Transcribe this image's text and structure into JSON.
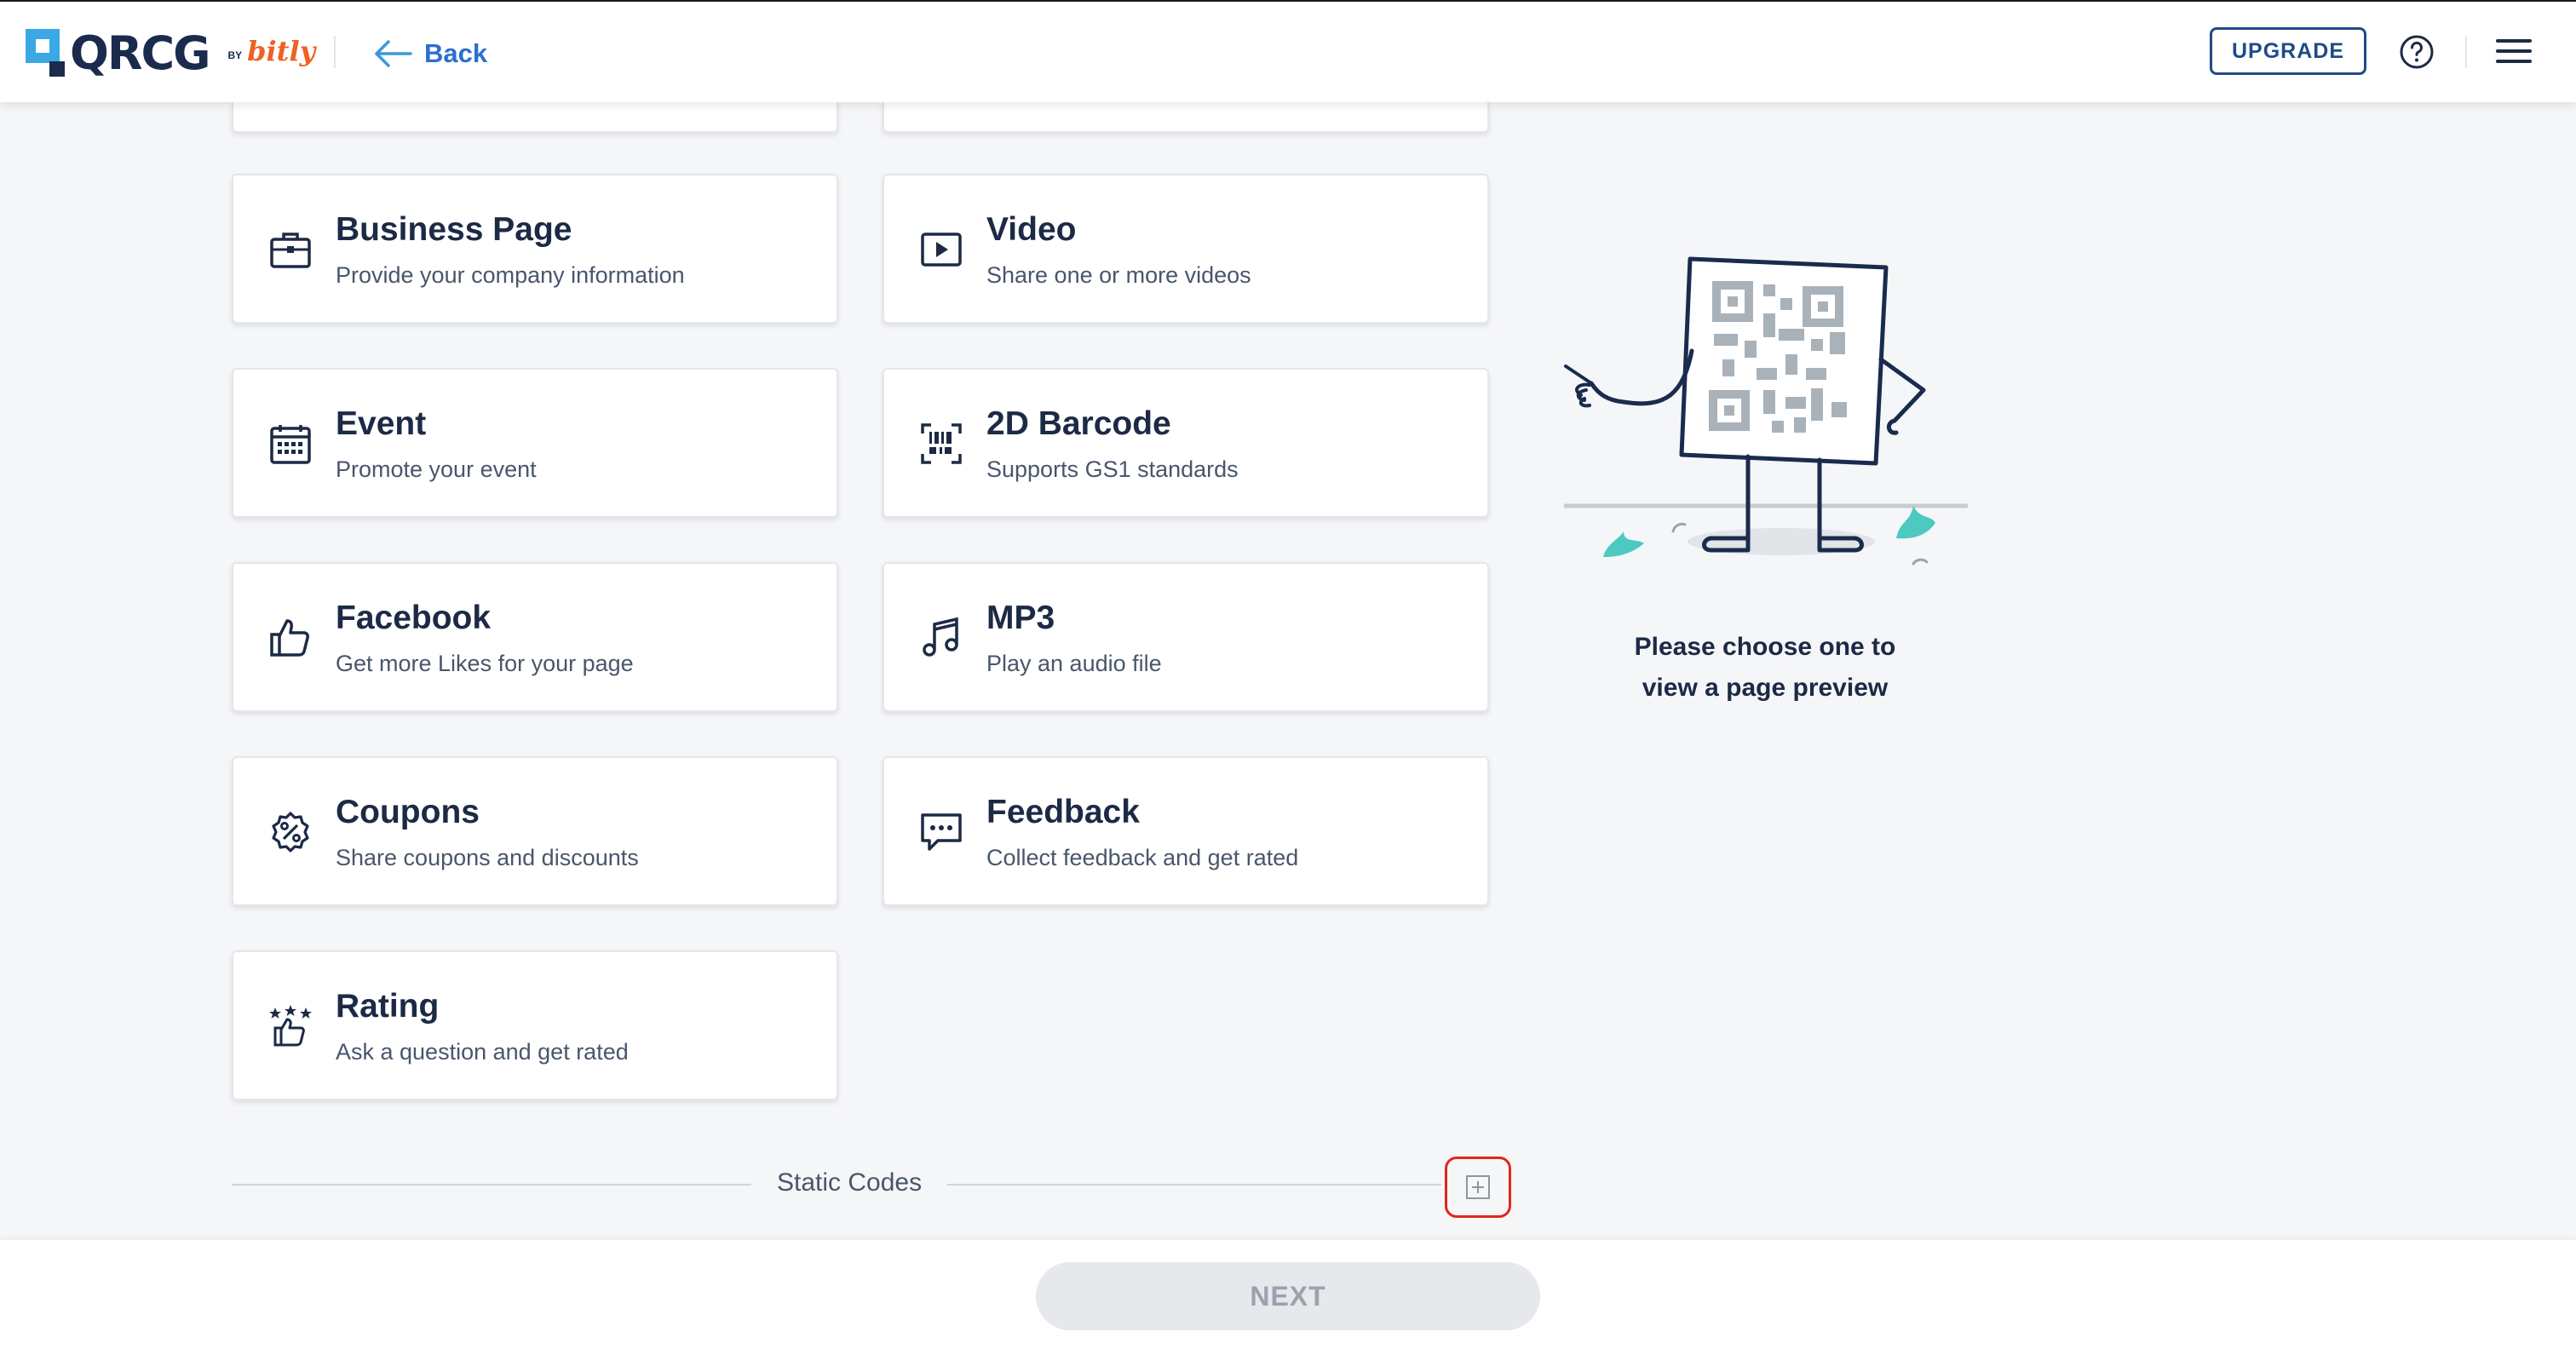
{
  "header": {
    "logo_text": "QRCG",
    "logo_by": "BY",
    "logo_bitly": "bitly",
    "back_label": "Back",
    "upgrade_label": "UPGRADE"
  },
  "cards": [
    {
      "title": "Business Page",
      "subtitle": "Provide your company information",
      "icon": "briefcase-icon"
    },
    {
      "title": "Video",
      "subtitle": "Share one or more videos",
      "icon": "video-play-icon"
    },
    {
      "title": "Event",
      "subtitle": "Promote your event",
      "icon": "calendar-icon"
    },
    {
      "title": "2D Barcode",
      "subtitle": "Supports GS1 standards",
      "icon": "barcode-scan-icon"
    },
    {
      "title": "Facebook",
      "subtitle": "Get more Likes for your page",
      "icon": "thumbs-up-icon"
    },
    {
      "title": "MP3",
      "subtitle": "Play an audio file",
      "icon": "music-note-icon"
    },
    {
      "title": "Coupons",
      "subtitle": "Share coupons and discounts",
      "icon": "percent-badge-icon"
    },
    {
      "title": "Feedback",
      "subtitle": "Collect feedback and get rated",
      "icon": "chat-bubble-icon"
    },
    {
      "title": "Rating",
      "subtitle": "Ask a question and get rated",
      "icon": "star-rating-icon"
    }
  ],
  "preview": {
    "line1": "Please choose one to",
    "line2": "view a page preview"
  },
  "section": {
    "label": "Static Codes"
  },
  "footer": {
    "next_label": "NEXT"
  }
}
